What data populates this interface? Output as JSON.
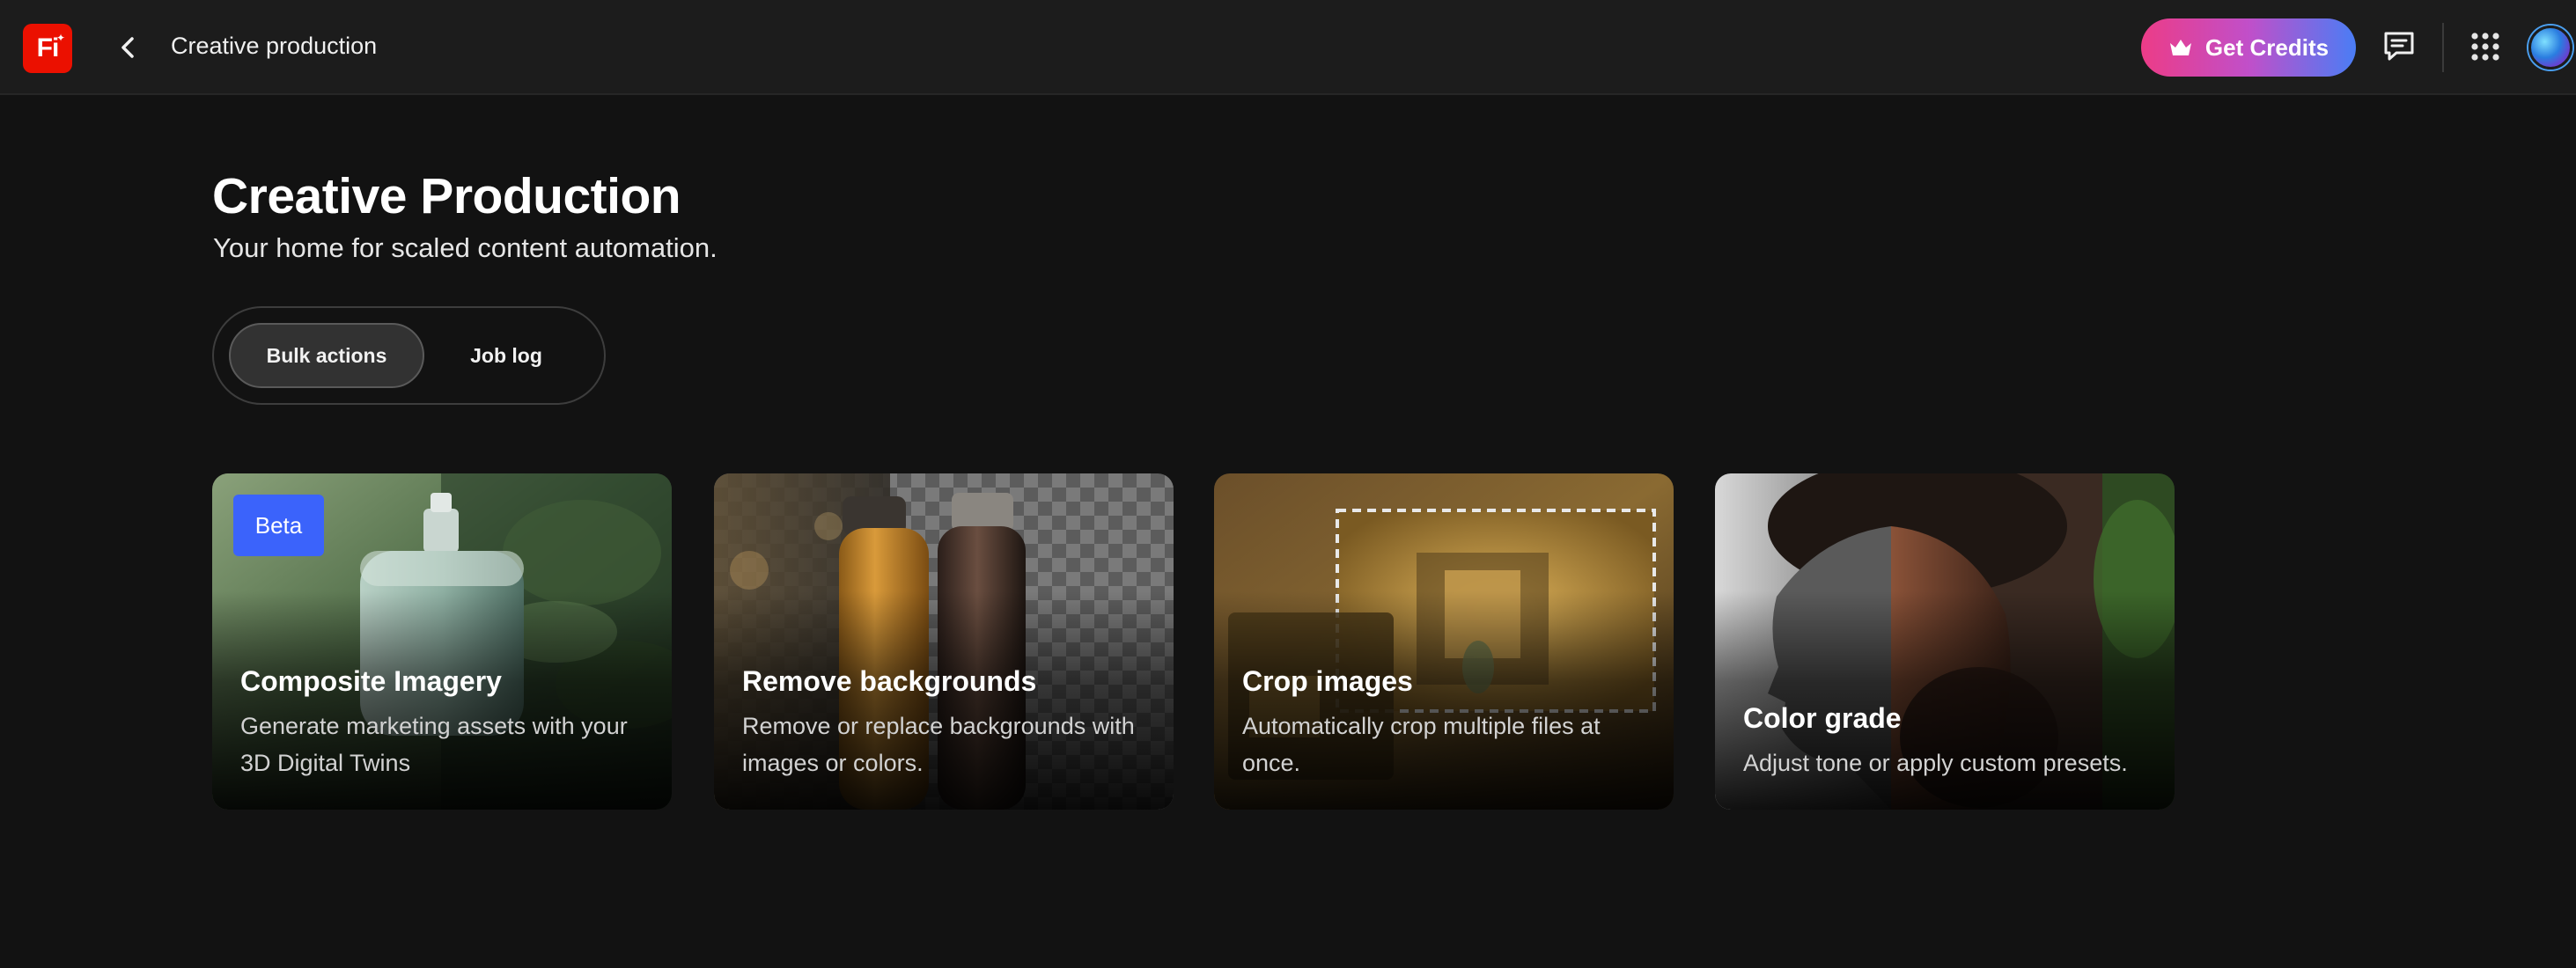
{
  "topbar": {
    "logo_text": "Fi",
    "title": "Creative production",
    "get_credits_label": "Get Credits"
  },
  "header": {
    "title": "Creative Production",
    "subtitle": "Your home for scaled content automation."
  },
  "tabs": [
    {
      "label": "Bulk actions",
      "active": true
    },
    {
      "label": "Job log",
      "active": false
    }
  ],
  "cards": [
    {
      "title": "Composite Imagery",
      "description": "Generate marketing assets with your 3D Digital Twins",
      "badge": "Beta"
    },
    {
      "title": "Remove backgrounds",
      "description": "Remove or replace backgrounds with images or colors."
    },
    {
      "title": "Crop images",
      "description": "Automatically crop multiple files at once."
    },
    {
      "title": "Color grade",
      "description": "Adjust tone or apply custom presets."
    }
  ],
  "colors": {
    "background": "#121212",
    "topbar": "#1c1c1c",
    "logo": "#eb1000",
    "credits_gradient_start": "#ec3c87",
    "credits_gradient_end": "#4a7df5",
    "beta_badge": "#3b63fb"
  },
  "icons": {
    "back": "chevron-left-icon",
    "credits": "crown-icon",
    "chat": "chat-bubble-icon",
    "apps": "app-grid-icon"
  }
}
